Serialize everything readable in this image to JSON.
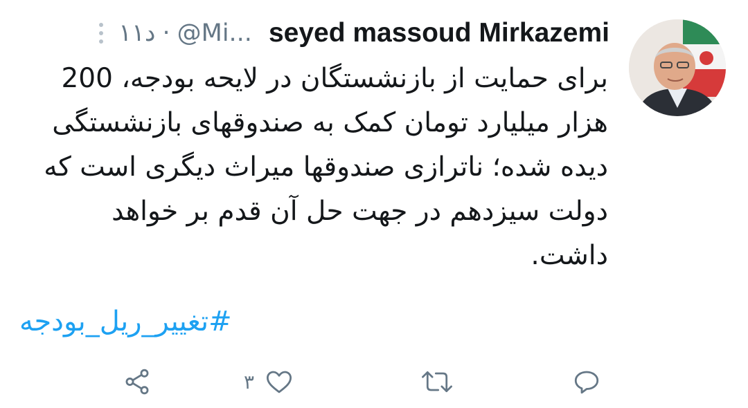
{
  "tweet": {
    "author_name": "seyed massoud Mirkazemi",
    "handle": "@Mi...",
    "meta_separator": "·",
    "time": "۱۱د",
    "body_lines": [
      "برای حمایت از بازنشستگان در لایحه بودجه، 200",
      "هزار میلیارد تومان کمک به صندوقهای بازنشستگی",
      "دیده شده؛ ناترازی صندوقها میراث دیگری است که",
      "دولت سیزدهم در جهت حل آن قدم بر خواهد",
      "داشت."
    ],
    "hashtag": "#تغییر_ریل_بودجه"
  },
  "actions": {
    "reply_icon": "reply-icon",
    "retweet_icon": "retweet-icon",
    "like_icon": "heart-icon",
    "like_count": "۳",
    "share_icon": "share-icon"
  },
  "colors": {
    "text": "#14171a",
    "muted": "#657786",
    "link": "#1da1f2"
  }
}
